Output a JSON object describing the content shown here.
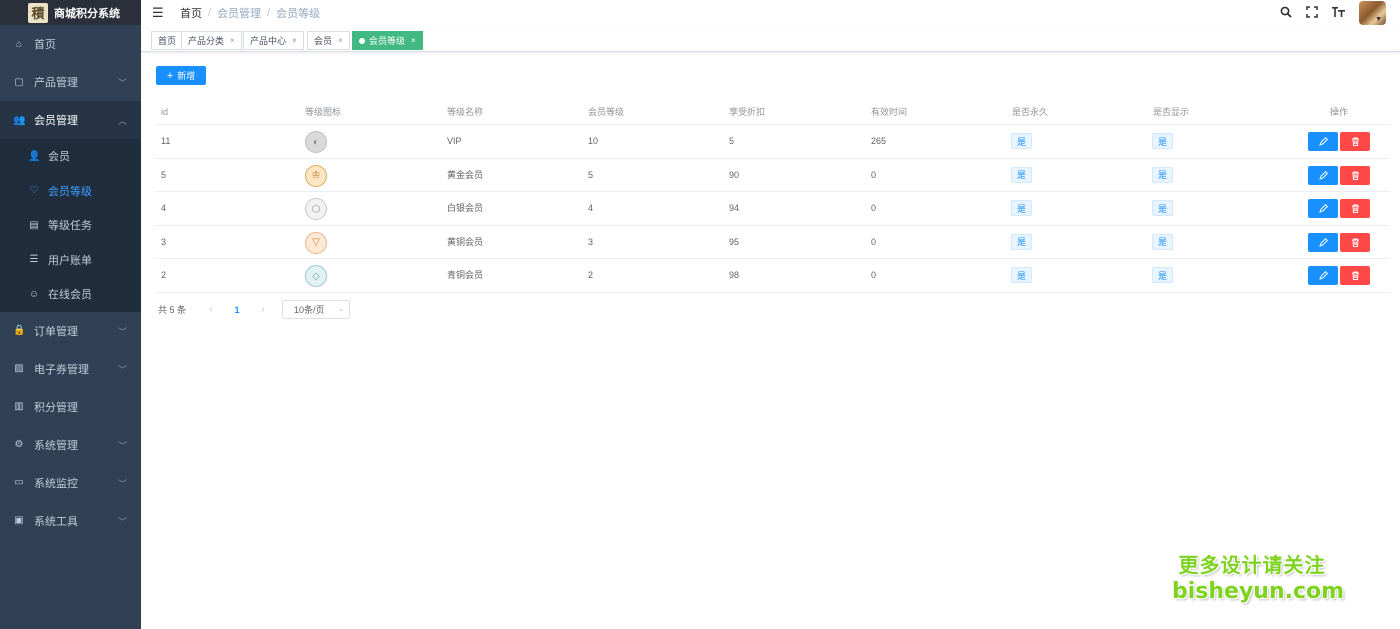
{
  "app": {
    "title": "商城积分系统",
    "logo_glyph": "積"
  },
  "sidebar": {
    "items": [
      {
        "label": "首页",
        "icon": "dashboard-icon",
        "glyph": "⌂",
        "expandable": false
      },
      {
        "label": "产品管理",
        "icon": "product-icon",
        "glyph": "▢",
        "expandable": true
      },
      {
        "label": "会员管理",
        "icon": "peoples-icon",
        "glyph": "👥",
        "expandable": true,
        "open": true,
        "children": [
          {
            "label": "会员",
            "icon": "user-icon",
            "glyph": "👤"
          },
          {
            "label": "会员等级",
            "icon": "level-icon",
            "glyph": "♡",
            "active": true
          },
          {
            "label": "等级任务",
            "icon": "task-icon",
            "glyph": "▤"
          },
          {
            "label": "用户账单",
            "icon": "list-icon",
            "glyph": "☰"
          },
          {
            "label": "在线会员",
            "icon": "online-icon",
            "glyph": "☺"
          }
        ]
      },
      {
        "label": "订单管理",
        "icon": "lock-icon",
        "glyph": "🔒",
        "expandable": true
      },
      {
        "label": "电子券管理",
        "icon": "coupon-icon",
        "glyph": "▨",
        "expandable": true
      },
      {
        "label": "积分管理",
        "icon": "points-icon",
        "glyph": "▥",
        "expandable": false
      },
      {
        "label": "系统管理",
        "icon": "system-icon",
        "glyph": "⚙",
        "expandable": true
      },
      {
        "label": "系统监控",
        "icon": "monitor-icon",
        "glyph": "▭",
        "expandable": true
      },
      {
        "label": "系统工具",
        "icon": "tool-icon",
        "glyph": "▣",
        "expandable": true
      }
    ]
  },
  "navbar": {
    "breadcrumb": [
      "首页",
      "会员管理",
      "会员等级"
    ],
    "icons": [
      "search-icon",
      "fullscreen-icon",
      "size-icon"
    ]
  },
  "tags": [
    {
      "label": "首页",
      "closable": false
    },
    {
      "label": "产品分类",
      "closable": true
    },
    {
      "label": "产品中心",
      "closable": true
    },
    {
      "label": "会员",
      "closable": true
    },
    {
      "label": "会员等级",
      "closable": true,
      "active": true
    }
  ],
  "toolbar": {
    "add_label": "新增"
  },
  "table": {
    "columns": [
      "id",
      "等级图标",
      "等级名称",
      "会员等级",
      "享受折扣",
      "有效时间",
      "是否永久",
      "是否显示",
      "操作"
    ],
    "rows": [
      {
        "id": "11",
        "icon_type": "broken",
        "name": "VIP",
        "level": "10",
        "discount": "5",
        "valid": "265",
        "permanent": "是",
        "show": "是"
      },
      {
        "id": "5",
        "icon_type": "gold",
        "name": "黄金会员",
        "level": "5",
        "discount": "90",
        "valid": "0",
        "permanent": "是",
        "show": "是"
      },
      {
        "id": "4",
        "icon_type": "silver",
        "name": "白银会员",
        "level": "4",
        "discount": "94",
        "valid": "0",
        "permanent": "是",
        "show": "是"
      },
      {
        "id": "3",
        "icon_type": "bronze",
        "name": "黄铜会员",
        "level": "3",
        "discount": "95",
        "valid": "0",
        "permanent": "是",
        "show": "是"
      },
      {
        "id": "2",
        "icon_type": "cyan",
        "name": "青铜会员",
        "level": "2",
        "discount": "98",
        "valid": "0",
        "permanent": "是",
        "show": "是"
      }
    ]
  },
  "pagination": {
    "total_label": "共 5 条",
    "current_page": "1",
    "page_size": "10条/页"
  },
  "watermark": {
    "line1": "更多设计请关注",
    "line2": "bisheyun.com"
  },
  "colors": {
    "primary": "#1890ff",
    "danger": "#ff4949",
    "sidebar": "#304156",
    "tag_active": "#42b983"
  }
}
